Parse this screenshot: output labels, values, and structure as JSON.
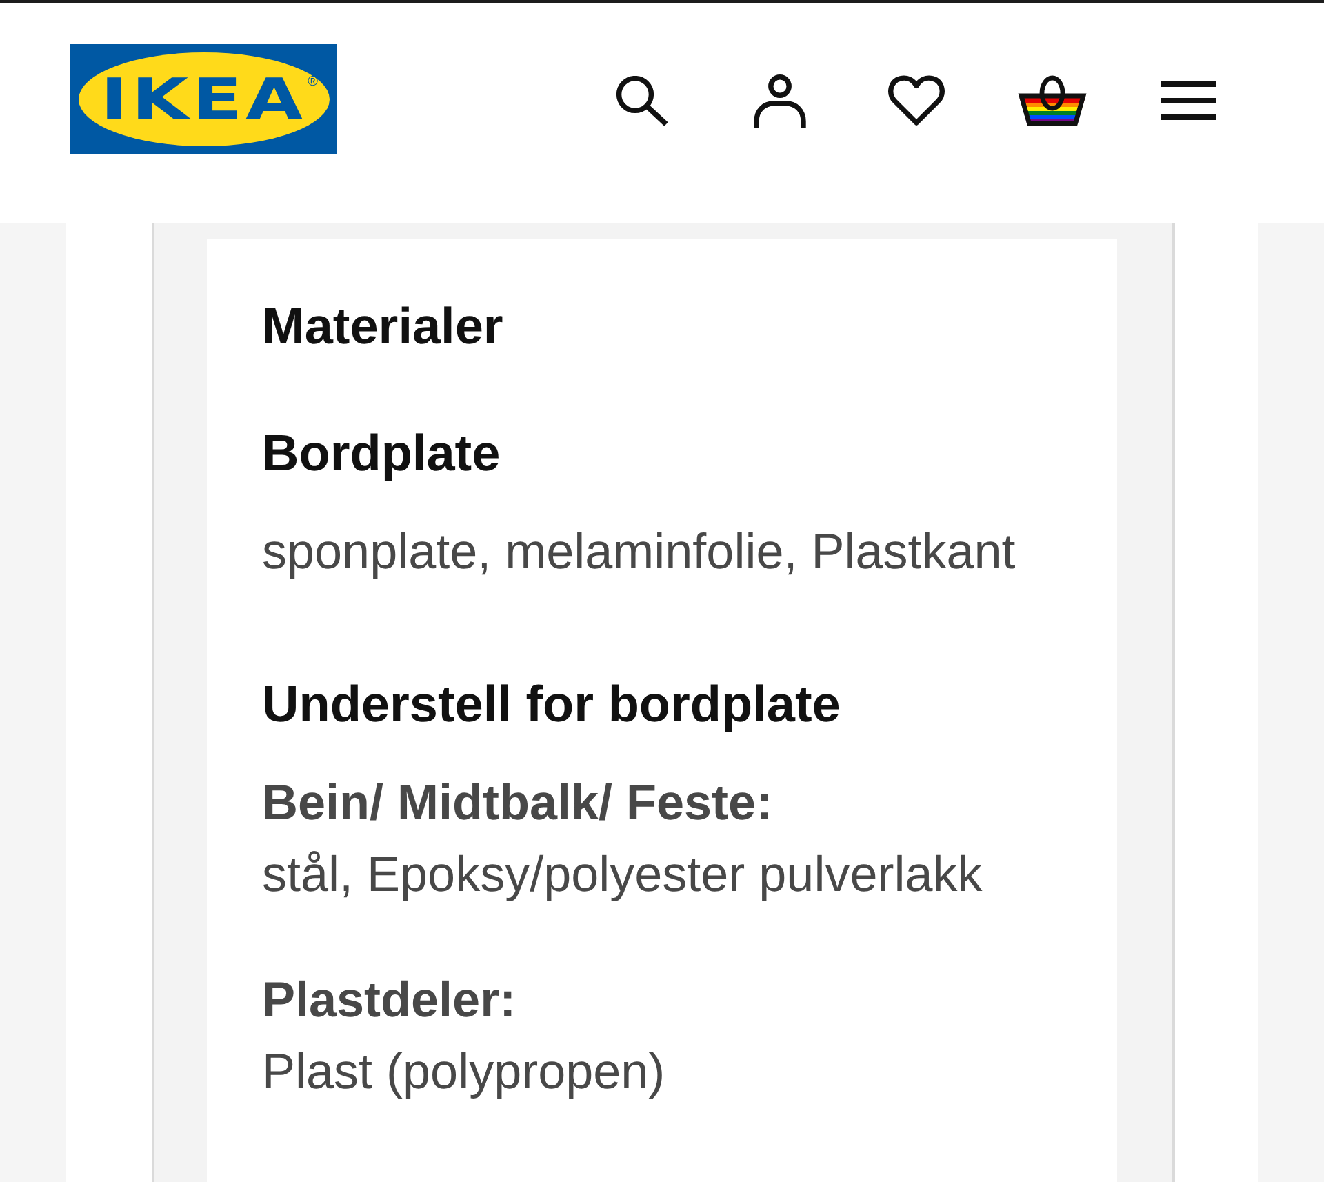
{
  "header": {
    "logo": {
      "text": "IKEA",
      "mark": "®"
    }
  },
  "materials": {
    "title": "Materialer",
    "groups": [
      {
        "title": "Bordplate",
        "items": [
          {
            "value": "sponplate, melaminfolie, Plastkant"
          }
        ]
      },
      {
        "title": "Understell for bordplate",
        "items": [
          {
            "label": "Bein/ Midtbalk/ Feste:",
            "value": "stål, Epoksy/polyester pulverlakk"
          },
          {
            "label": "Plastdeler:",
            "value": "Plast (polypropen)"
          }
        ]
      }
    ]
  }
}
